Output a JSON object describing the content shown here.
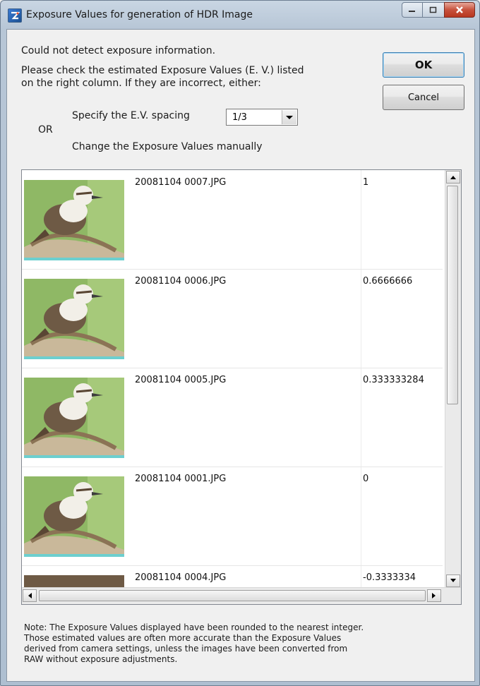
{
  "window": {
    "title": "Exposure Values for generation of HDR Image"
  },
  "message": {
    "line1": "Could not detect exposure information.",
    "line2": "Please check the estimated Exposure Values (E. V.) listed",
    "line3": "on the right column. If they are incorrect, either:",
    "spacing_label": "Specify the E.V.  spacing",
    "or_label": "OR",
    "manual_label": "Change the Exposure Values manually"
  },
  "spacing": {
    "selected": "1/3"
  },
  "buttons": {
    "ok": "OK",
    "cancel": "Cancel"
  },
  "images": [
    {
      "filename": "20081104 0007.JPG",
      "ev": "1"
    },
    {
      "filename": "20081104 0006.JPG",
      "ev": "0.6666666"
    },
    {
      "filename": "20081104 0005.JPG",
      "ev": "0.333333284"
    },
    {
      "filename": "20081104 0001.JPG",
      "ev": "0"
    },
    {
      "filename": "20081104 0004.JPG",
      "ev": "-0.3333334"
    }
  ],
  "note": {
    "line1": "Note: The Exposure Values displayed have been rounded to the nearest integer.",
    "line2": "Those estimated values are often more accurate than the Exposure Values",
    "line3": "derived from camera settings, unless the images have been converted from",
    "line4": "RAW without exposure adjustments."
  },
  "icons": [
    "app-icon",
    "minimize-icon",
    "maximize-icon",
    "close-icon",
    "dropdown-arrow-icon",
    "scroll-up-icon",
    "scroll-down-icon",
    "scroll-left-icon",
    "scroll-right-icon"
  ]
}
